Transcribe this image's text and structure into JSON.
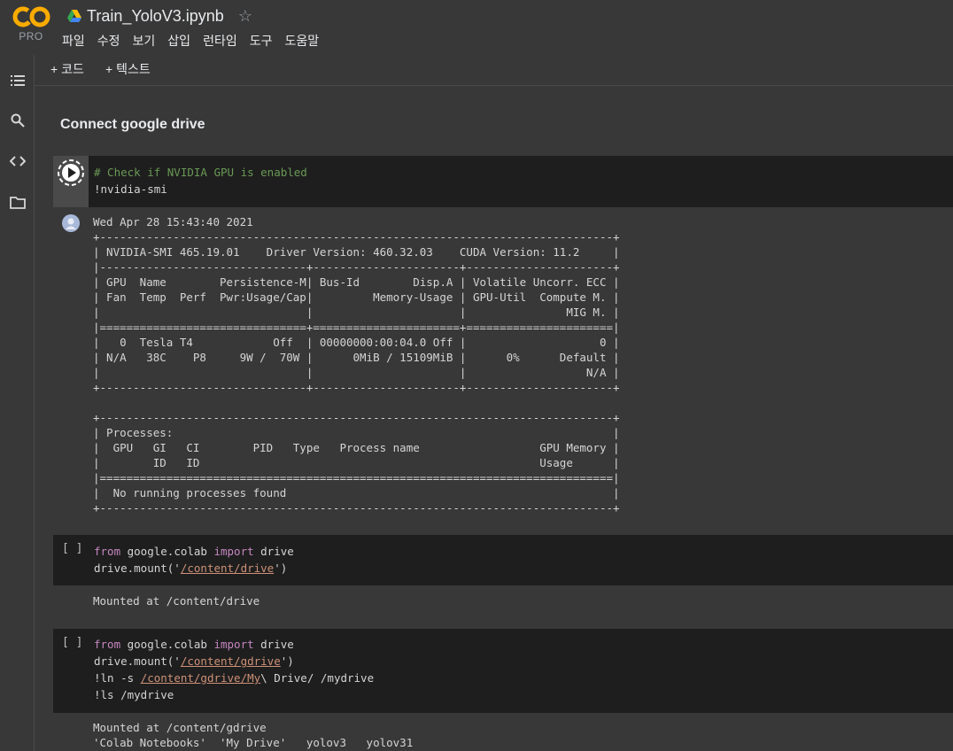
{
  "header": {
    "logo_label": "PRO",
    "title": "Train_YoloV3.ipynb",
    "star": "☆"
  },
  "menu": [
    "파일",
    "수정",
    "보기",
    "삽입",
    "런타임",
    "도구",
    "도움말"
  ],
  "toolbar": {
    "add_code": "+ 코드",
    "add_text": "+ 텍스트"
  },
  "rail_icons": [
    "toc-icon",
    "search-icon",
    "code-snippets-icon",
    "folder-icon"
  ],
  "section_title": "Connect google drive",
  "cells": [
    {
      "comment": "# Check if NVIDIA GPU is enabled",
      "line2": "!nvidia-smi",
      "output": [
        "Wed Apr 28 15:43:40 2021",
        "+-----------------------------------------------------------------------------+",
        "| NVIDIA-SMI 465.19.01    Driver Version: 460.32.03    CUDA Version: 11.2     |",
        "|-------------------------------+----------------------+----------------------+",
        "| GPU  Name        Persistence-M| Bus-Id        Disp.A | Volatile Uncorr. ECC |",
        "| Fan  Temp  Perf  Pwr:Usage/Cap|         Memory-Usage | GPU-Util  Compute M. |",
        "|                               |                      |               MIG M. |",
        "|===============================+======================+======================|",
        "|   0  Tesla T4            Off  | 00000000:00:04.0 Off |                    0 |",
        "| N/A   38C    P8     9W /  70W |      0MiB / 15109MiB |      0%      Default |",
        "|                               |                      |                  N/A |",
        "+-------------------------------+----------------------+----------------------+",
        "",
        "+-----------------------------------------------------------------------------+",
        "| Processes:                                                                  |",
        "|  GPU   GI   CI        PID   Type   Process name                  GPU Memory |",
        "|        ID   ID                                                   Usage      |",
        "|=============================================================================|",
        "|  No running processes found                                                 |",
        "+-----------------------------------------------------------------------------+"
      ]
    },
    {
      "bracket": "[ ]",
      "l1_kw1": "from",
      "l1_mid": " google.colab ",
      "l1_kw2": "import",
      "l1_end": " drive",
      "l2_pre": "drive.mount('",
      "l2_str": "/content/drive",
      "l2_post": "')",
      "output": [
        "Mounted at /content/drive"
      ]
    },
    {
      "bracket": "[ ]",
      "l1_kw1": "from",
      "l1_mid": " google.colab ",
      "l1_kw2": "import",
      "l1_end": " drive",
      "l2_pre": "drive.mount('",
      "l2_str": "/content/gdrive",
      "l2_post": "')",
      "l3_pre": "!ln -s ",
      "l3_str": "/content/gdrive/My",
      "l3_post": "\\ Drive/ /mydrive",
      "l4": "!ls /mydrive",
      "output": [
        "Mounted at /content/gdrive",
        "'Colab Notebooks'  'My Drive'   yolov3   yolov31"
      ]
    }
  ],
  "colors": {
    "background": "#383838",
    "cell_bg": "#1e1e1e",
    "comment": "#6a9955",
    "keyword": "#c586c0",
    "string": "#ce9178"
  }
}
